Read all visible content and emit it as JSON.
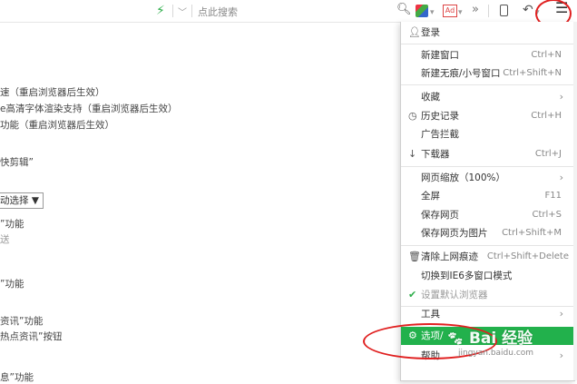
{
  "toolbar": {
    "search_placeholder": "点此搜索",
    "ad_icon_label": "Ad"
  },
  "settings": {
    "lines": [
      "速（重启浏览器后生效）",
      "e高清字体渲染支持（重启浏览器后生效）",
      "功能（重启浏览器后生效）",
      "快剪辑”",
      "”功能",
      "送",
      "”功能",
      "资讯”功能",
      "热点资讯”按钮",
      "息”功能"
    ],
    "select_value": "动选择"
  },
  "menu": {
    "login": "登录",
    "items": [
      {
        "label": "新建窗口",
        "shortcut": "Ctrl+N"
      },
      {
        "label": "新建无痕/小号窗口",
        "shortcut": "Ctrl+Shift+N"
      },
      {
        "label": "收藏",
        "shortcut": ""
      },
      {
        "label": "历史记录",
        "shortcut": "Ctrl+H"
      },
      {
        "label": "广告拦截",
        "shortcut": ""
      },
      {
        "label": "下载器",
        "shortcut": "Ctrl+J"
      },
      {
        "label": "网页缩放（100%）",
        "shortcut": ""
      },
      {
        "label": "全屏",
        "shortcut": "F11"
      },
      {
        "label": "保存网页",
        "shortcut": "Ctrl+S"
      },
      {
        "label": "保存网页为图片",
        "shortcut": "Ctrl+Shift+M"
      },
      {
        "label": "清除上网痕迹",
        "shortcut": "Ctrl+Shift+Delete"
      },
      {
        "label": "切换到IE6多窗口模式",
        "shortcut": ""
      },
      {
        "label": "设置默认浏览器",
        "shortcut": ""
      },
      {
        "label": "工具",
        "shortcut": ""
      },
      {
        "label": "选项/",
        "shortcut": ""
      },
      {
        "label": "帮助",
        "shortcut": ""
      }
    ]
  },
  "watermark": {
    "brand": "Bai 经验",
    "url": "jingyan.baidu.com"
  },
  "colors": {
    "highlight": "#22b14c",
    "annotation": "#e02020",
    "bolt": "#2eae4a"
  }
}
